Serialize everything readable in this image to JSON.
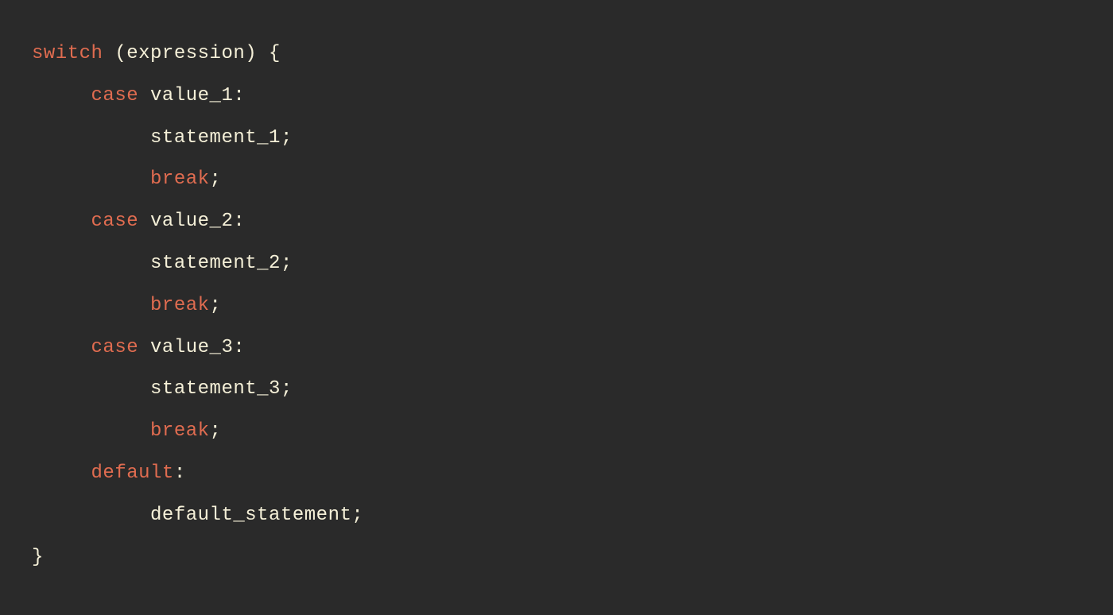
{
  "code": {
    "line1": {
      "kw": "switch",
      "rest": " (expression) {"
    },
    "line2": {
      "indent": "     ",
      "kw": "case",
      "rest": " value_1:"
    },
    "line3": {
      "indent": "          ",
      "rest": "statement_1;"
    },
    "line4": {
      "indent": "          ",
      "kw": "break",
      "rest": ";"
    },
    "line5": {
      "indent": "     ",
      "kw": "case",
      "rest": " value_2:"
    },
    "line6": {
      "indent": "          ",
      "rest": "statement_2;"
    },
    "line7": {
      "indent": "          ",
      "kw": "break",
      "rest": ";"
    },
    "line8": {
      "indent": "     ",
      "kw": "case",
      "rest": " value_3:"
    },
    "line9": {
      "indent": "          ",
      "rest": "statement_3;"
    },
    "line10": {
      "indent": "          ",
      "kw": "break",
      "rest": ";"
    },
    "line11": {
      "indent": "     ",
      "kw": "default",
      "rest": ":"
    },
    "line12": {
      "indent": "          ",
      "rest": "default_statement;"
    },
    "line13": {
      "rest": "}"
    }
  }
}
